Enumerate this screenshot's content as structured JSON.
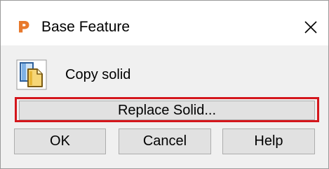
{
  "window": {
    "title": "Base Feature",
    "app_icon": "powermill-p-logo-icon",
    "close_symbol": "✕"
  },
  "option": {
    "icon": "copy-solid-icon",
    "label": "Copy solid"
  },
  "buttons": {
    "replace_label": "Replace Solid...",
    "ok_label": "OK",
    "cancel_label": "Cancel",
    "help_label": "Help"
  },
  "colors": {
    "highlight": "#d4161c",
    "logo": "#e8792c",
    "dialog_bg": "#f0f0f0",
    "button_bg": "#e1e1e1"
  }
}
